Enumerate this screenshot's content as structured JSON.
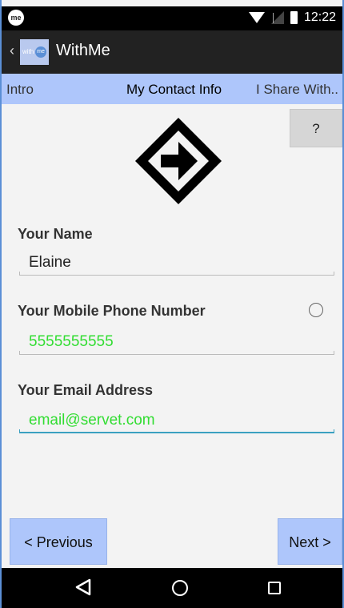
{
  "status_bar": {
    "logo": "me",
    "time": "12:22"
  },
  "app_bar": {
    "title": "WithMe",
    "logo_small_text": "with",
    "logo_badge_text": "me"
  },
  "tabs": [
    {
      "label": "Intro"
    },
    {
      "label": "My Contact Info"
    },
    {
      "label": "I Share With.."
    }
  ],
  "help_button": {
    "label": "?"
  },
  "form": {
    "name": {
      "label": "Your Name",
      "value": "Elaine",
      "value_color": "#222222"
    },
    "phone": {
      "label": "Your Mobile Phone Number",
      "value": "5555555555",
      "value_color": "#33dd33"
    },
    "email": {
      "label": "Your Email Address",
      "value": "email@servet.com",
      "value_color": "#33dd33"
    }
  },
  "buttons": {
    "previous": "< Previous",
    "next": "Next >"
  },
  "colors": {
    "accent": "#aec6fb",
    "focus_underline": "#3aa0c0",
    "bar_dark": "#222222"
  }
}
